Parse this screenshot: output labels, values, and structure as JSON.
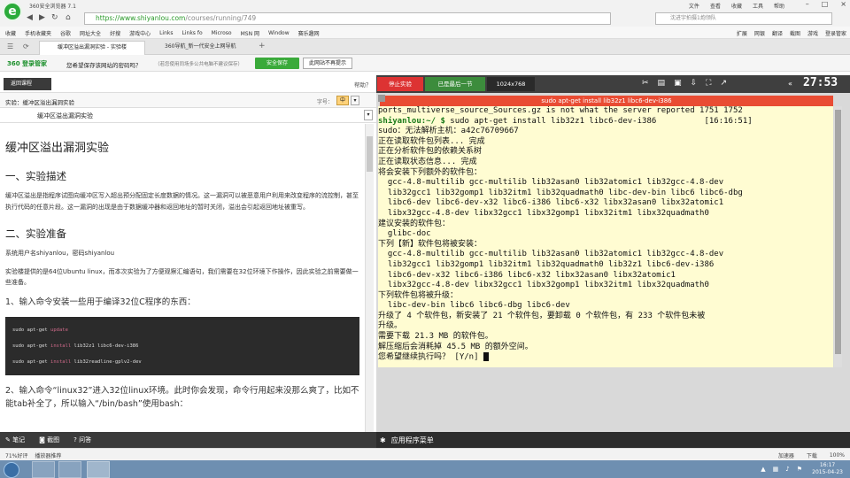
{
  "browser": {
    "title": "360安全浏览器 7.1",
    "menus": [
      "文件",
      "查看",
      "收藏",
      "工具",
      "帮助"
    ],
    "url_host": "https://www.shiyanlou.com",
    "url_path": "/courses/running/749",
    "search_placeholder": "沈进宇拍摄1炮领队",
    "favorites": [
      "收藏",
      "手机收藏夹",
      "谷歌",
      "网址大全",
      "好搜",
      "游戏中心",
      "Links",
      "Links fo",
      "Microso",
      "MSN 网",
      "Window",
      "赛乐趣网"
    ],
    "fav_right": [
      "扩展",
      "网银",
      "翻译",
      "截图",
      "游戏",
      "登录管家"
    ],
    "tabs": [
      "缓冲区溢出漏洞实验 - 实验楼",
      "360导航_新一代安全上网导航"
    ],
    "security": {
      "brand": "360 登录管家",
      "question": "您希望保存该网站的密码吗？",
      "tip": "（若您使用同场多公共电脑不建议保存）",
      "save": "安全保存",
      "never": "此网站不再提示"
    }
  },
  "left": {
    "back": "返回课程",
    "help": "帮助？",
    "experiment_label": "实验：缓冲区溢出漏洞实验",
    "font_size_label": "字号：",
    "font_size_value": "中",
    "section_title": "缓冲区溢出漏洞实验",
    "h1": "缓冲区溢出漏洞实验",
    "h2_1": "一、实验描述",
    "p1": "缓冲区溢出是指程序试图向缓冲区写入超出预分配固定长度数据的情况。这一漏洞可以被恶意用户利用来改变程序的流控制，甚至执行代码的任意片段。这一漏洞的出现是由于数据缓冲器和返回地址的暂时关闭，溢出会引起返回地址被重写。",
    "h2_2": "二、实验准备",
    "p2": "系统用户名shiyanlou，密码shiyanlou",
    "p3": "实验楼提供的是64位Ubuntu linux，而本次实验为了方便观察汇编语句，我们需要在32位环境下作操作，因此实验之前需要做一些准备。",
    "p4": "1、输入命令安装一些用于编译32位C程序的东西：",
    "code": [
      {
        "cmd": "sudo apt-get ",
        "kw": "update",
        "rest": ""
      },
      {
        "cmd": "sudo apt-get ",
        "kw": "install",
        "rest": " lib32z1 libc6-dev-i386"
      },
      {
        "cmd": "sudo apt-get ",
        "kw": "install",
        "rest": " lib32readline-gplv2-dev"
      }
    ],
    "p5": "2、输入命令“linux32”进入32位linux环境。此时你会发现，命令行用起来没那么爽了，比如不能tab补全了，所以输入“/bin/bash”使用bash：",
    "tools": [
      "笔记",
      "截图",
      "问答"
    ]
  },
  "vm": {
    "stop": "停止实验",
    "latest": "已是最后一节",
    "resolution": "1024x768",
    "timer": "27:53",
    "window_title": "sudo apt-get install lib32z1 libc6-dev-i386",
    "appmenu": "应用程序菜单",
    "lines": [
      "ports_multiverse_source_Sources.gz is not what the server reported 1751 1752",
      "__PROMPT__",
      "sudo：无法解析主机：a42c76709667",
      "正在读取软件包列表... 完成",
      "正在分析软件包的依赖关系树",
      "正在读取状态信息... 完成",
      "将会安装下列额外的软件包：",
      "  gcc-4.8-multilib gcc-multilib lib32asan0 lib32atomic1 lib32gcc-4.8-dev",
      "  lib32gcc1 lib32gomp1 lib32itm1 lib32quadmath0 libc-dev-bin libc6 libc6-dbg",
      "  libc6-dev libc6-dev-x32 libc6-i386 libc6-x32 libx32asan0 libx32atomic1",
      "  libx32gcc-4.8-dev libx32gcc1 libx32gomp1 libx32itm1 libx32quadmath0",
      "建议安装的软件包：",
      "  glibc-doc",
      "下列【新】软件包将被安装：",
      "  gcc-4.8-multilib gcc-multilib lib32asan0 lib32atomic1 lib32gcc-4.8-dev",
      "  lib32gcc1 lib32gomp1 lib32itm1 lib32quadmath0 lib32z1 libc6-dev-i386",
      "  libc6-dev-x32 libc6-i386 libc6-x32 libx32asan0 libx32atomic1",
      "  libx32gcc-4.8-dev libx32gcc1 libx32gomp1 libx32itm1 libx32quadmath0",
      "下列软件包将被升级：",
      "  libc-dev-bin libc6 libc6-dbg libc6-dev",
      "升级了 4 个软件包，新安装了 21 个软件包，要卸载 0 个软件包，有 233 个软件包未被",
      "升级。",
      "需要下载 21.3 MB 的软件包。",
      "解压缩后会消耗掉 45.5 MB 的额外空间。",
      "__ASK__"
    ],
    "prompt_user": "shiyanlou:~/ $ ",
    "prompt_cmd": "sudo apt-get install lib32z1 libc6-dev-i386",
    "prompt_time": "[16:16:51]",
    "ask": "您希望继续执行吗？ [Y/n] "
  },
  "status": {
    "left": [
      "71%好评",
      "播放器推荐"
    ],
    "right": [
      "加速器",
      "下载",
      "100%"
    ]
  },
  "taskbar": {
    "time": "16:17",
    "date": "2015-04-23"
  }
}
